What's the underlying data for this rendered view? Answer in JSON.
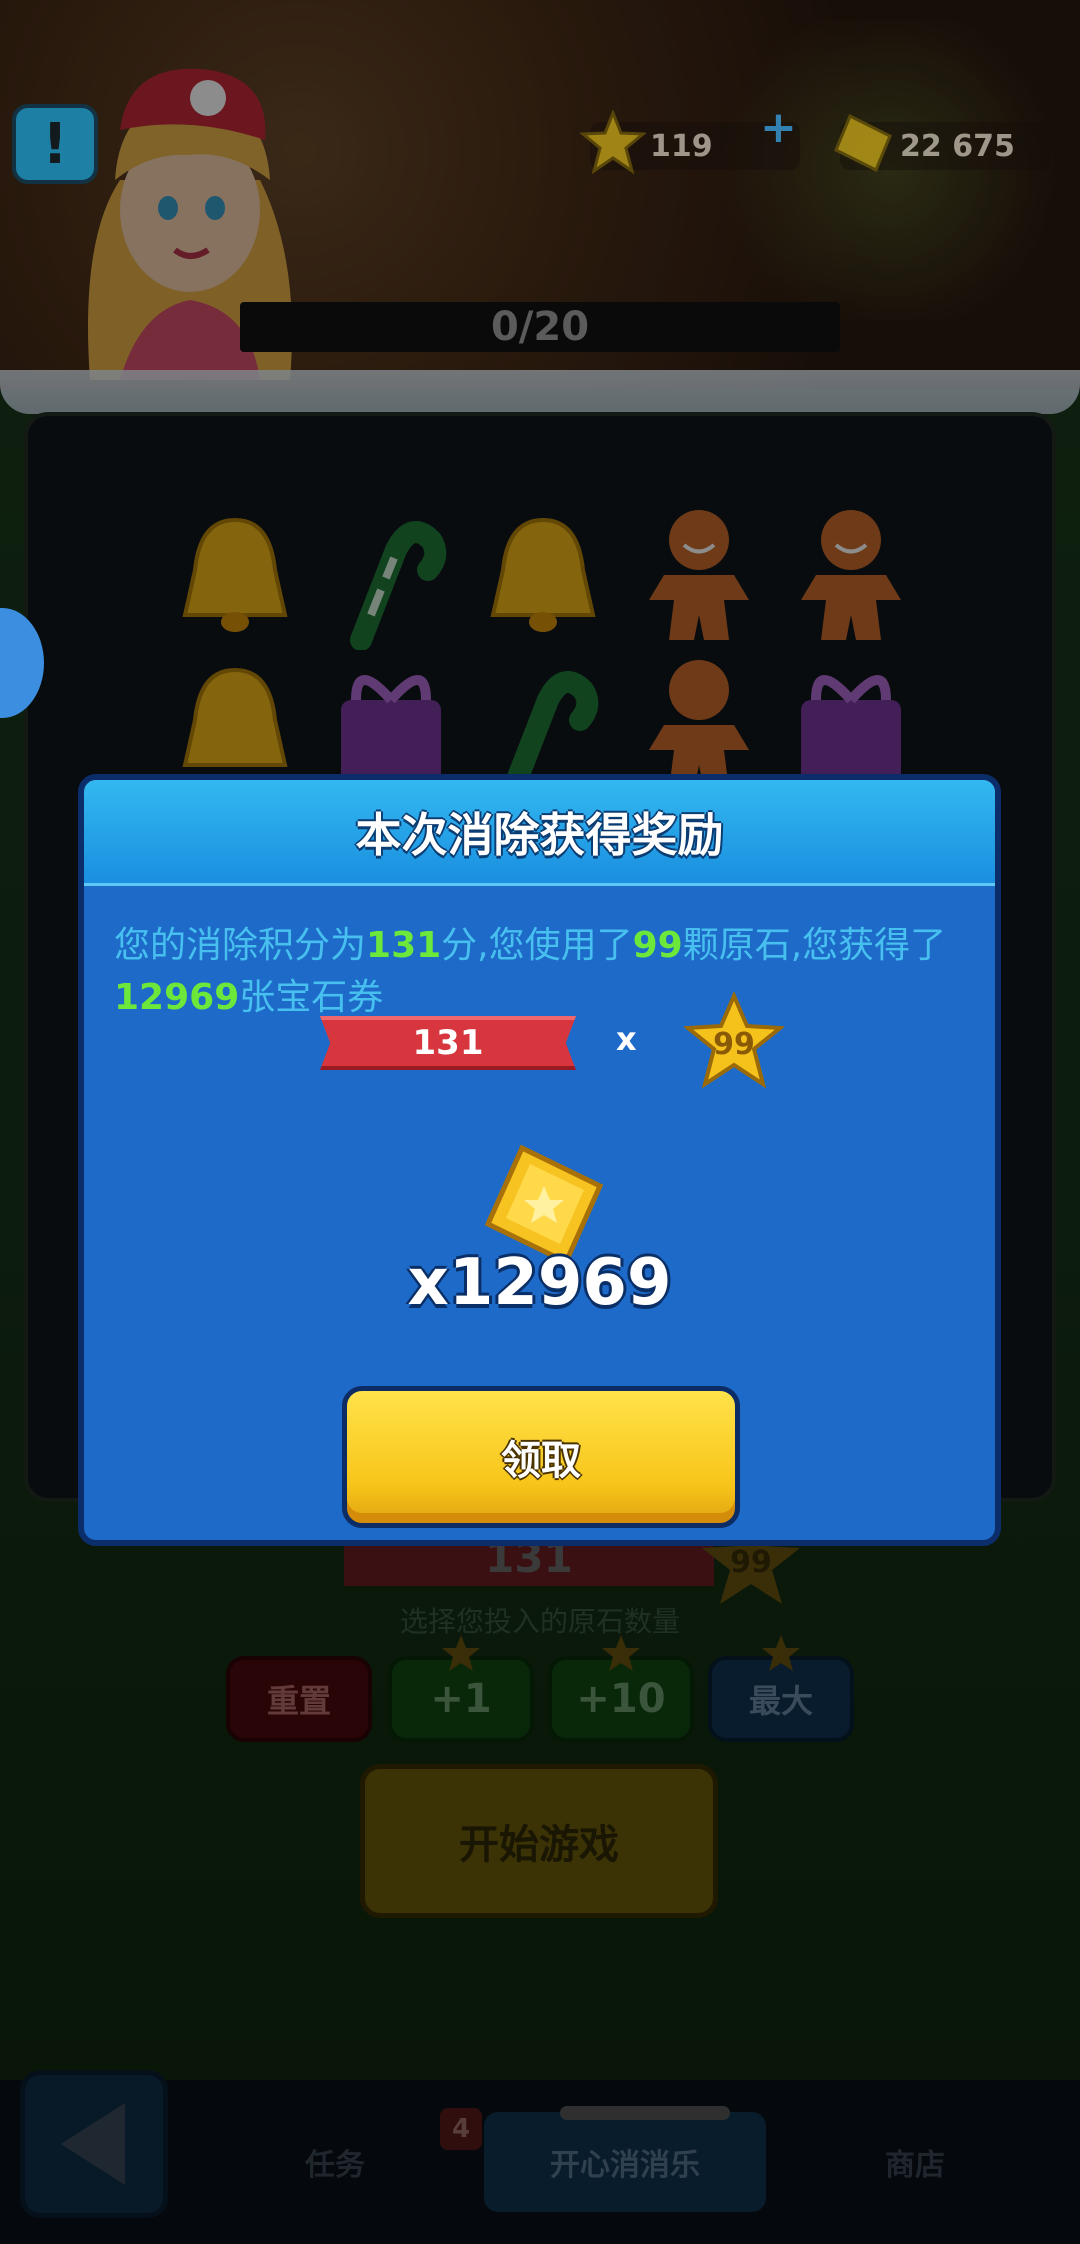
{
  "hud": {
    "alert_label": "!",
    "stars_value": "119",
    "plus_label": "+",
    "gems_value": "22 675",
    "progress_text": "0/20"
  },
  "board": {
    "tiles": [
      "bell-icon",
      "candy-cane-icon",
      "bell-icon",
      "gingerbread-icon",
      "gingerbread-icon",
      "bell-icon",
      "gift-box-icon",
      "candy-cane-icon",
      "gingerbread-icon",
      "gift-box-icon"
    ]
  },
  "lower": {
    "score_value": "131",
    "star_value": "99",
    "hint_text": "选择您投入的原石数量",
    "reset_label": "重置",
    "plus1_label": "+1",
    "plus10_label": "+10",
    "max_label": "最大",
    "start_label": "开始游戏"
  },
  "nav": {
    "tasks_label": "任务",
    "tasks_badge": "4",
    "play_label": "开心消消乐",
    "shop_label": "商店"
  },
  "modal": {
    "title": "本次消除获得奖励",
    "msg_part1": "您的消除积分为",
    "msg_score": "131",
    "msg_part2": "分,您使用了",
    "msg_stones": "99",
    "msg_part3": "颗原石,您获得了",
    "msg_tickets": "12969",
    "msg_part4": "张宝石券",
    "ribbon_value": "131",
    "multiply_sign": "x",
    "star_badge_value": "99",
    "reward_count": "x12969",
    "claim_label": "领取"
  },
  "colors": {
    "modal_blue": "#1e6ac8",
    "header_blue": "#33b8f0",
    "highlight_green": "#6be83a",
    "message_cyan": "#47c0ef",
    "claim_yellow": "#f8c61a",
    "ribbon_red": "#d8363f"
  }
}
